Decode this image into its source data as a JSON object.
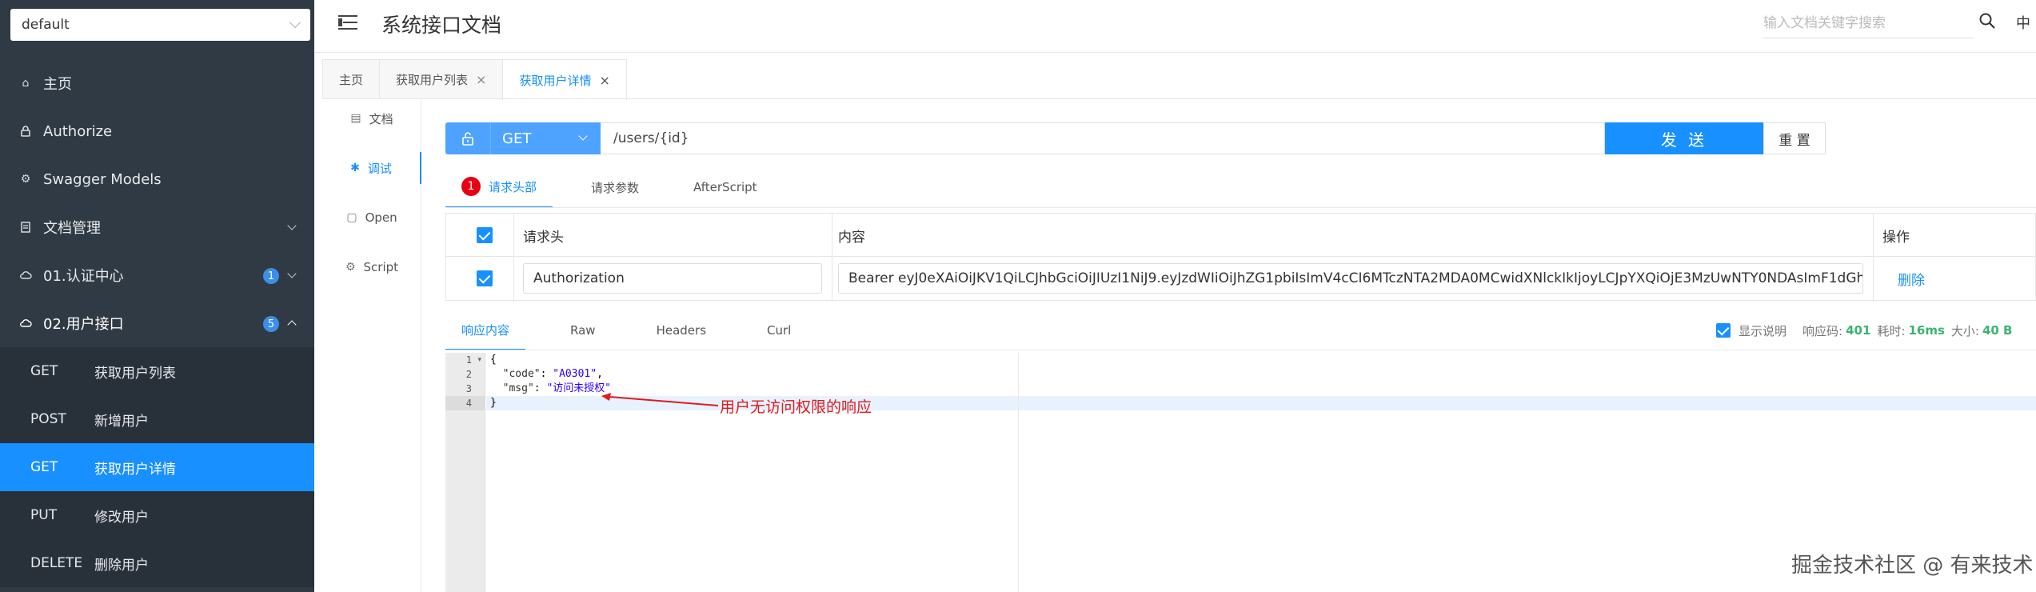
{
  "sidebar": {
    "group_select": "default",
    "items": [
      {
        "icon": "home-icon",
        "label": "主页"
      },
      {
        "icon": "lock-icon",
        "label": "Authorize"
      },
      {
        "icon": "gear-icon",
        "label": "Swagger Models"
      },
      {
        "icon": "doc-icon",
        "label": "文档管理"
      },
      {
        "icon": "cloud-icon",
        "label": "01.认证中心",
        "badge": "1"
      },
      {
        "icon": "cloud-icon",
        "label": "02.用户接口",
        "badge": "5"
      }
    ],
    "sub_items": [
      {
        "method": "GET",
        "label": "获取用户列表"
      },
      {
        "method": "POST",
        "label": "新增用户"
      },
      {
        "method": "GET",
        "label": "获取用户详情"
      },
      {
        "method": "PUT",
        "label": "修改用户"
      },
      {
        "method": "DELETE",
        "label": "删除用户"
      }
    ]
  },
  "header": {
    "title": "系统接口文档",
    "search_placeholder": "输入文档关键字搜索",
    "lang": "中"
  },
  "tabs": [
    {
      "label": "主页"
    },
    {
      "label": "获取用户列表",
      "close": "×"
    },
    {
      "label": "获取用户详情",
      "close": "×"
    }
  ],
  "inner_nav": [
    {
      "label": "文档"
    },
    {
      "label": "调试"
    },
    {
      "label": "Open"
    },
    {
      "label": "Script"
    }
  ],
  "request": {
    "method": "GET",
    "url": "/users/{id}",
    "send_label": "发 送",
    "reset_label": "重 置"
  },
  "req_tabs": {
    "headers_badge": "1",
    "headers": "请求头部",
    "params": "请求参数",
    "after": "AfterScript"
  },
  "header_table": {
    "col_name": "请求头",
    "col_value": "内容",
    "col_action": "操作",
    "row_name": "Authorization",
    "row_value": "Bearer eyJ0eXAiOiJKV1QiLCJhbGciOiJIUzI1NiJ9.eyJzdWIiOiJhZG1pbiIsImV4cCI6MTczNTA2MDA0MCwidXNlckIkIjoyLCJpYXQiOjE3MzUwNTY0NDAsImF1dGh",
    "delete": "删除"
  },
  "resp_tabs": {
    "content": "响应内容",
    "raw": "Raw",
    "headers": "Headers",
    "curl": "Curl"
  },
  "resp_meta": {
    "show_desc": "显示说明",
    "code_label": "响应码:",
    "code": "401",
    "time_label": "耗时:",
    "time": "16ms",
    "size_label": "大小:",
    "size": "40 B"
  },
  "editor": {
    "line_numbers": [
      "1",
      "2",
      "3",
      "4"
    ],
    "l1": "{",
    "l2_key": "  \"code\"",
    "l2_sep": ": ",
    "l2_val": "\"A0301\"",
    "l2_end": ",",
    "l3_key": "  \"msg\"",
    "l3_sep": ": ",
    "l3_val": "\"访问未授权\"",
    "l4": "}"
  },
  "annotation": "用户无访问权限的响应",
  "watermark": "掘金技术社区 @ 有来技术",
  "colors": {
    "primary": "#1890ff",
    "sidebar": "#303a44",
    "error": "#e60012",
    "annotation": "#e3191c"
  }
}
